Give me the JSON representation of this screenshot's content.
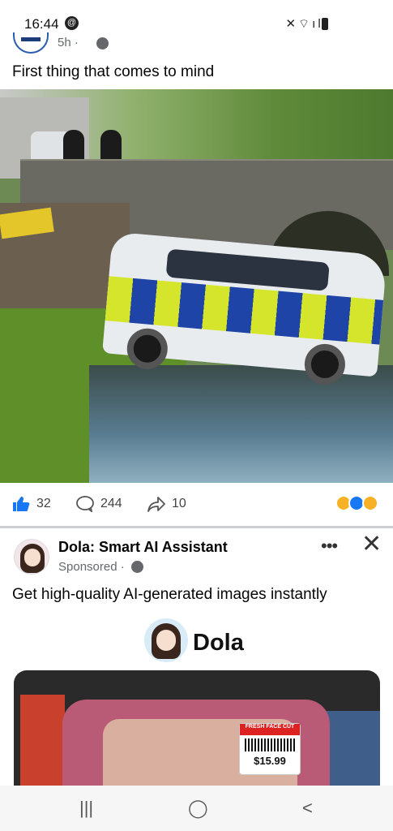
{
  "status_bar": {
    "time": "16:44",
    "dnd_glyph": "@",
    "right_icons": "✕⌔ıll"
  },
  "post": {
    "time": "5h ·",
    "caption": "First thing that comes to mind",
    "reactions": {
      "like_count": "32",
      "comment_count": "244",
      "share_count": "10"
    }
  },
  "ad": {
    "name": "Dola: Smart AI Assistant",
    "sponsored": "Sponsored ·",
    "more": "•••",
    "close": "✕",
    "text": "Get high-quality AI-generated images instantly",
    "brand": "Dola",
    "price_header": "FRESH FACE CUT",
    "price": "$15.99"
  },
  "navbar": {
    "recents": "|||",
    "home": "◯",
    "back": "<"
  },
  "colors": {
    "fb_blue": "#1877f2",
    "meta_gray": "#65676b"
  }
}
